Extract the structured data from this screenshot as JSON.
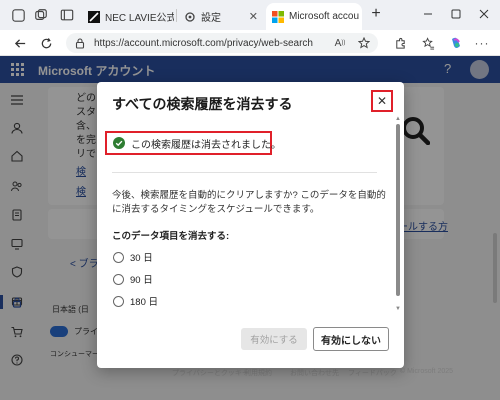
{
  "browser": {
    "tabs": [
      {
        "label": "NEC LAVIE公式",
        "active": false
      },
      {
        "label": "設定",
        "active": false
      },
      {
        "label": "Microsoft accou",
        "active": true
      }
    ],
    "new_tab_glyph": "+",
    "url": "https://account.microsoft.com/privacy/web-search",
    "icons": [
      "tab-actions-icon",
      "workspaces-icon",
      "tab-list-icon",
      "back-icon",
      "refresh-icon",
      "lock-icon",
      "read-aloud-icon",
      "favorite-icon",
      "extensions-icon",
      "favorites-icon",
      "copilot-icon",
      "more-icon"
    ]
  },
  "page": {
    "header_title": "Microsoft アカウント",
    "help_glyph": "?",
    "bg_lines": [
      "どの",
      "スタ",
      "含、",
      "を完",
      "リで"
    ],
    "bg_links": [
      "検",
      "検"
    ],
    "bg_right_link": "ュールする方",
    "bg_back_link": "< ブラ",
    "bg_lang": "日本語 (日",
    "bg_privacy": "プライ",
    "bg_consumer": "コンシューマーの正",
    "footer": [
      "プライバシーとクッキー",
      "利用規約",
      "お問い合わせ先",
      "フィードバック",
      "© Microsoft 2025"
    ]
  },
  "dialog": {
    "title": "すべての検索履歴を消去する",
    "close_glyph": "✕",
    "success_message": "この検索履歴は消去されました。",
    "description": "今後、検索履歴を自動的にクリアしますか? このデータを自動的に消去するタイミングをスケジュールできます。",
    "section_label": "このデータ項目を消去する:",
    "options": [
      {
        "label": "30 日",
        "selected": false
      },
      {
        "label": "90 日",
        "selected": false
      },
      {
        "label": "180 日",
        "selected": false
      }
    ],
    "enable_button": "有効にする",
    "disable_button": "有効にしない"
  },
  "colors": {
    "header_blue": "#2b50a0",
    "highlight_red": "#e0202a",
    "success_green": "#2e7d32"
  }
}
